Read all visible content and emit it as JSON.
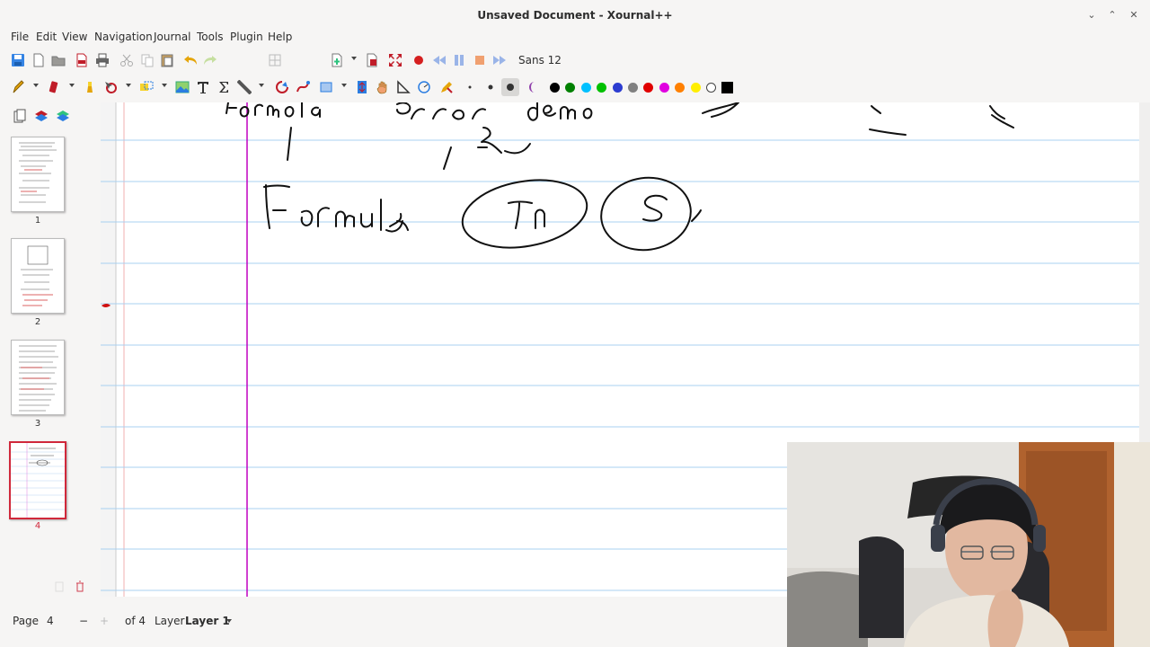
{
  "window": {
    "title": "Unsaved Document - Xournal++"
  },
  "menu": [
    "File",
    "Edit",
    "View",
    "Navigation",
    "Journal",
    "Tools",
    "Plugin",
    "Help"
  ],
  "toolbar": {
    "font": "Sans  12",
    "colors": [
      "#000000",
      "#008000",
      "#00c0ff",
      "#00c000",
      "#2c3cd0",
      "#808080",
      "#e00000",
      "#e000e0",
      "#ff8000",
      "#ffee00",
      "#ffffff",
      "#000000"
    ]
  },
  "sidebar": {
    "pages": [
      {
        "number": "1"
      },
      {
        "number": "2"
      },
      {
        "number": "3"
      },
      {
        "number": "4",
        "selected": true
      }
    ]
  },
  "status": {
    "page_label": "Page",
    "page_value": "4",
    "minus": "−",
    "plus": "+",
    "of_pages": "of 4",
    "layer_label": "Layer",
    "layer_value": "Layer 1"
  },
  "canvas": {
    "handwriting": [
      "Formula",
      "error demo",
      "Formula",
      "Tn",
      "S"
    ]
  }
}
